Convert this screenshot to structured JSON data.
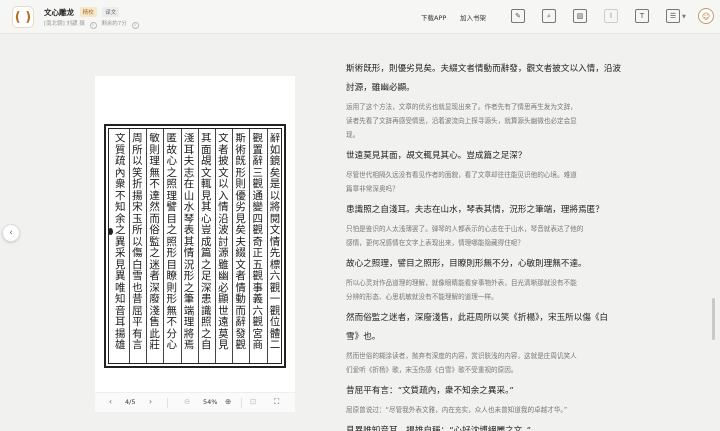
{
  "header": {
    "logo_glyph": "( )",
    "book_title": "文心雕龙",
    "tag_vip": "精校",
    "tag_type": "译文",
    "author": "[南北朝] 刘勰 撰",
    "progress_note": "剩余約7分",
    "link_app": "下载APP",
    "link_shelf": "加入书架",
    "tools": [
      "note-icon",
      "search-icon",
      "image-icon",
      "columns-icon",
      "text-icon",
      "layout-icon"
    ],
    "avatar_glyph": "☺"
  },
  "scan": {
    "columns": [
      "辭如鏡矣是以將閱文情先標六觀一觀位體二",
      "觀置辭三觀通變四觀奇正五觀事義六觀宮商",
      "斯術旣形則優劣見矣夫綴文者情動而辭發觀",
      "文者披文以入情沿波討源雖幽必顯世遠莫見",
      "其面覘文輒見其心豈成篇之足深患識照之自",
      "淺耳夫志在山水琴表其情況形之筆端理將焉",
      "匿故心之照理譬目之照形目瞭則形無不分心",
      "敏則理無不達然而俗監之迷者深廢淺售此莊",
      "周所以笑折揚宋玉所以傷白雪也昔屈平有言",
      "文質疏內衆不知余之異采見異唯知音耳揚雄"
    ],
    "page_indicator": "4/5",
    "zoom": "54%",
    "prev_glyph": "‹",
    "next_glyph": "›",
    "zoom_out_glyph": "⊖",
    "zoom_in_glyph": "⊕",
    "fit_glyph": "⊡",
    "fullscreen_glyph": "⛶"
  },
  "text": [
    {
      "o": [
        "斯術旣形，則優劣見矣。夫綴文者情動而辭發，觀文者披文以入情，沿波",
        "討源，雖幽必顯。"
      ],
      "t": [
        "运用了这个方法，文章的优劣也就显现出来了。作者先有了情思再生发为文辞，",
        "读者先看了文辞再感受情思，沿着波流向上探寻源头，就算源头幽微也必定会显",
        "现。"
      ]
    },
    {
      "o": [
        "世遠莫見其面，覘文輒見其心。豈成篇之足深？"
      ],
      "t": [
        "尽管世代相隔久远没有看见作者的面貌，看了文章却往往能见识他的心境。难道",
        "篇章非常深奥吗？"
      ]
    },
    {
      "o": [
        "患識照之自淺耳。夫志在山水，琴表其情，況形之筆端，理將焉匿？"
      ],
      "t": [
        "只怕是鉴识的人太浅薄罢了。弹琴的人都表示的心志在于山水，琴音就表达了他的",
        "感情，更何况感情在文字上表现出来，情理哪能隐藏得住呢？"
      ]
    },
    {
      "o": [
        "故心之照理，譬目之照形，目瞭則形無不分，心敏則理無不達。"
      ],
      "t": [
        "所以心灵对作品道理的理解，就像眼睛能看穿事物外表，目光清晰那就没有不能",
        "分辨的形态、心思机敏就没有不能理解的道理一样。"
      ]
    },
    {
      "o": [
        "然而俗監之迷者，深廢淺售，此莊周所以笑《折楊》，宋玉所以傷《白",
        "雪》也。"
      ],
      "t": [
        "然而世俗的糊涂读者，抛弃有深度的内容，赏识肤浅的内容，这就是庄周讥笑人",
        "们爱听《折杨》歌，宋玉伤感《白雪》歌不受重视的原因。"
      ]
    },
    {
      "o": [
        "昔屈平有言：“文質疏內，衆不知余之異采。”"
      ],
      "t": [
        "屈原曾说过：“尽管我外表文雅，内在充实，众人也未曾知道我的卓越才华。”"
      ]
    },
    {
      "o": [
        "見異唯知音耳。揚雄自稱：“心好沈博絕麗之文。”"
      ],
      "t": []
    }
  ]
}
